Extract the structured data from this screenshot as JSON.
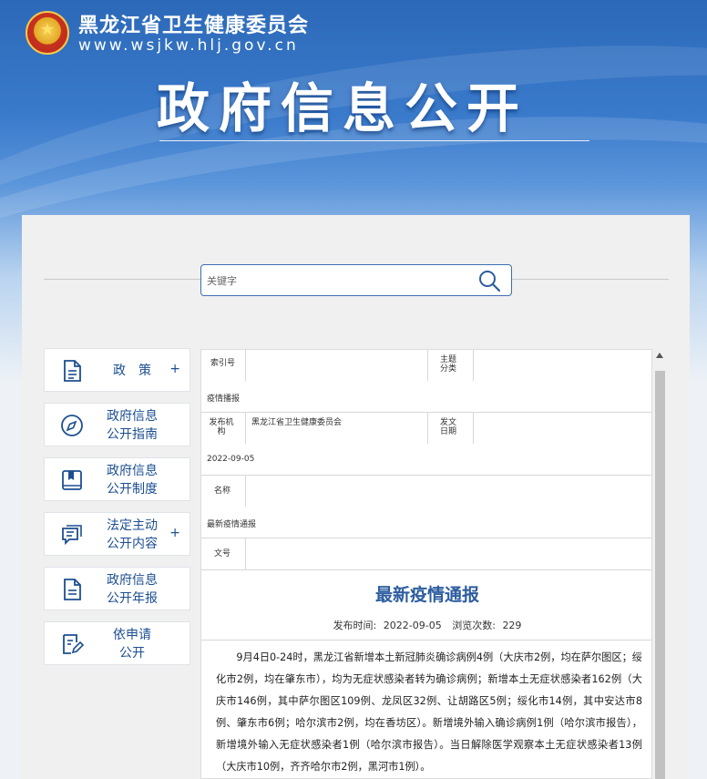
{
  "header": {
    "site_name": "黑龙江省卫生健康委员会",
    "site_url": "www.wsjkw.hlj.gov.cn",
    "hero_title": "政府信息公开"
  },
  "search": {
    "placeholder": "关键字"
  },
  "sidebar": {
    "items": [
      {
        "label": "政　策",
        "plus": "+",
        "icon": "document-icon"
      },
      {
        "label": "政府信息\n公开指南",
        "icon": "compass-icon"
      },
      {
        "label": "政府信息\n公开制度",
        "icon": "book-icon"
      },
      {
        "label": "法定主动\n公开内容",
        "plus": "+",
        "icon": "chat-list-icon"
      },
      {
        "label": "政府信息\n公开年报",
        "icon": "report-icon"
      },
      {
        "label": "依申请\n公开",
        "icon": "edit-form-icon"
      }
    ]
  },
  "meta": {
    "index_label": "索引号",
    "index_value": "",
    "category_label": "主题分类",
    "category_value": "疫情播报",
    "issuer_label": "发布机构",
    "issuer_value": "黑龙江省卫生健康委员会",
    "date_label": "发文日期",
    "date_value": "2022-09-05",
    "name_label": "名称",
    "name_value": "最新疫情通报",
    "docno_label": "文号",
    "docno_value": ""
  },
  "article": {
    "title": "最新疫情通报",
    "publish_label": "发布时间:",
    "publish_date": "2022-09-05",
    "views_label": "浏览次数:",
    "views": "229",
    "body": "9月4日0-24时，黑龙江省新增本土新冠肺炎确诊病例4例（大庆市2例，均在萨尔图区；绥化市2例，均在肇东市），均为无症状感染者转为确诊病例；新增本土无症状感染者162例（大庆市146例，其中萨尔图区109例、龙凤区32例、让胡路区5例；绥化市14例，其中安达市8例、肇东市6例；哈尔滨市2例，均在香坊区）。新增境外输入确诊病例1例（哈尔滨市报告），新增境外输入无症状感染者1例（哈尔滨市报告）。当日解除医学观察本土无症状感染者13例（大庆市10例，齐齐哈尔市2例，黑河市1例）。"
  }
}
